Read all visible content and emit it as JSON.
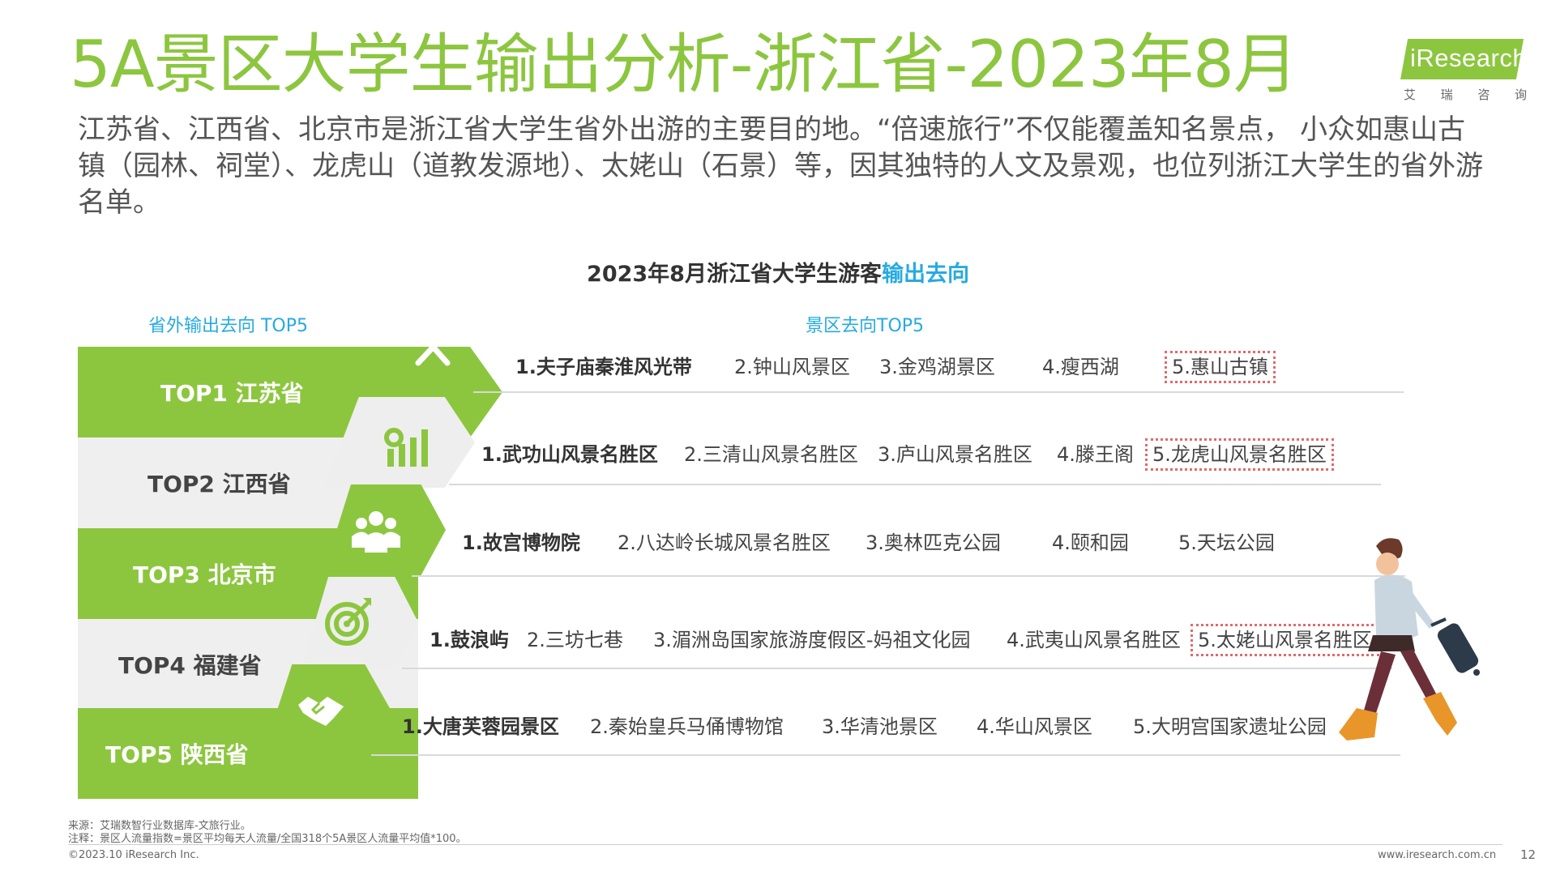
{
  "title": "5A景区大学生输出分析-浙江省-2023年8月",
  "logo": {
    "text": "iResearch",
    "sub": [
      "艾",
      "瑞",
      "咨",
      "询"
    ]
  },
  "intro": "江苏省、江西省、北京市是浙江省大学生省外出游的主要目的地。“倍速旅行”不仅能覆盖知名景点， 小众如惠山古镇（园林、祠堂）、龙虎山（道教发源地）、太姥山（石景）等，因其独特的人文及景观，也位列浙江大学生的省外游名单。",
  "chart": {
    "title_prefix": "2023年8月浙江省大学生游客",
    "title_highlight": "输出去向",
    "left_header": "省外输出去向 TOP5",
    "right_header": "景区去向TOP5"
  },
  "rows": [
    {
      "province": "TOP1 江苏省",
      "icon": "tools-icon",
      "style": "green",
      "spots": [
        "1.夫子庙秦淮风光带",
        "2.钟山风景区",
        "3.金鸡湖景区",
        "4.瘦西湖",
        "5.惠山古镇"
      ],
      "highlight": 4
    },
    {
      "province": "TOP2 江西省",
      "icon": "gear-chart-icon",
      "style": "grey",
      "spots": [
        "1.武功山风景名胜区",
        "2.三清山风景名胜区",
        "3.庐山风景名胜区",
        "4.滕王阁",
        "5.龙虎山风景名胜区"
      ],
      "highlight": 4
    },
    {
      "province": "TOP3 北京市",
      "icon": "people-group-icon",
      "style": "green",
      "spots": [
        "1.故宫博物院",
        "2.八达岭长城风景名胜区",
        "3.奥林匹克公园",
        "4.颐和园",
        "5.天坛公园"
      ],
      "highlight": -1
    },
    {
      "province": "TOP4 福建省",
      "icon": "target-icon",
      "style": "grey",
      "spots": [
        "1.鼓浪屿",
        "2.三坊七巷",
        "3.湄洲岛国家旅游度假区-妈祖文化园",
        "4.武夷山风景名胜区",
        "5.太姥山风景名胜区"
      ],
      "highlight": 4
    },
    {
      "province": "TOP5 陕西省",
      "icon": "handshake-icon",
      "style": "green",
      "spots": [
        "1.大唐芙蓉园景区",
        "2.秦始皇兵马俑博物馆",
        "3.华清池景区",
        "4.华山风景区",
        "5.大明宫国家遗址公园"
      ],
      "highlight": -1
    }
  ],
  "footer": {
    "source": "来源：艾瑞数智行业数据库-文旅行业。",
    "note": "注释：景区人流量指数=景区平均每天人流量/全国318个5A景区人流量平均值*100。",
    "copyright": "©2023.10  iResearch Inc.",
    "site": "www.iresearch.com.cn",
    "page": "12"
  },
  "colors": {
    "green": "#8cc63f",
    "blue": "#27aae1",
    "highlight_border": "#e06a6a"
  }
}
